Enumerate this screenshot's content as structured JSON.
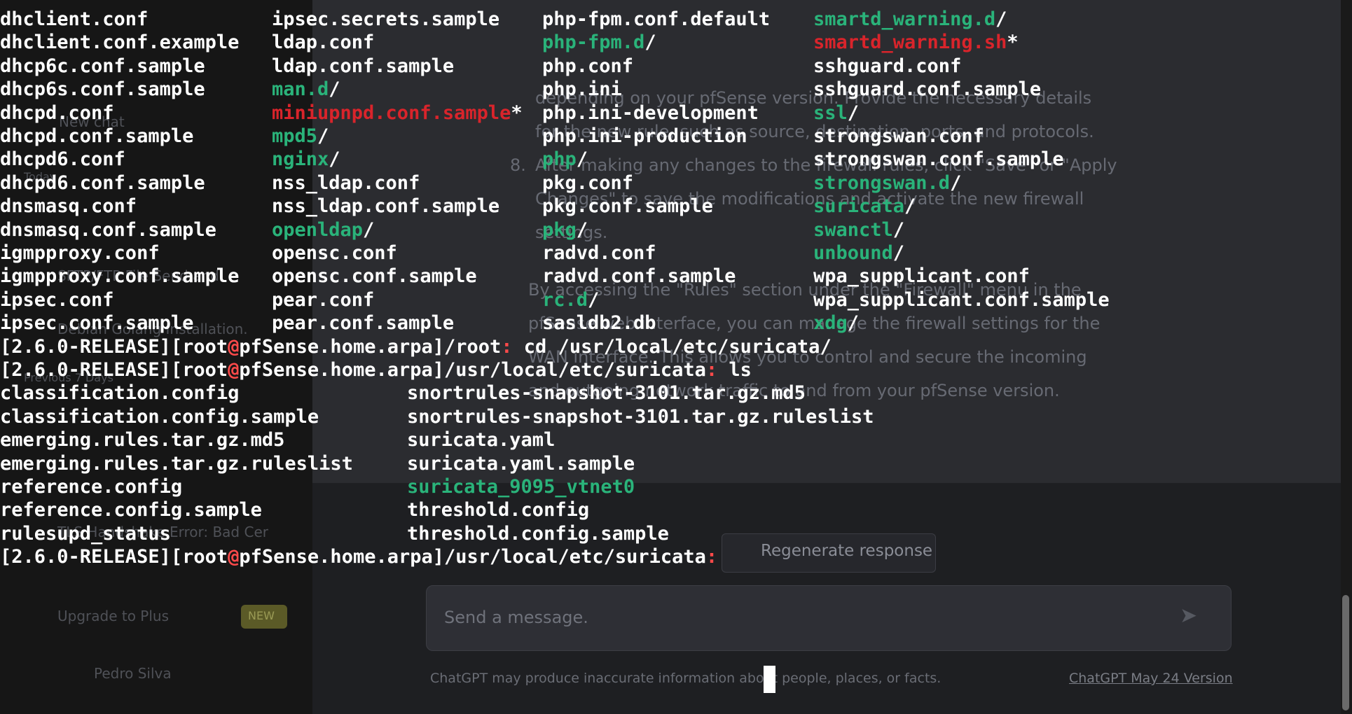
{
  "ls_etc": {
    "columns": [
      [
        {
          "name": "dhclient.conf",
          "kind": "file"
        },
        {
          "name": "dhclient.conf.example",
          "kind": "file"
        },
        {
          "name": "dhcp6c.conf.sample",
          "kind": "file"
        },
        {
          "name": "dhcp6s.conf.sample",
          "kind": "file"
        },
        {
          "name": "dhcpd.conf",
          "kind": "file"
        },
        {
          "name": "dhcpd.conf.sample",
          "kind": "file"
        },
        {
          "name": "dhcpd6.conf",
          "kind": "file"
        },
        {
          "name": "dhcpd6.conf.sample",
          "kind": "file"
        },
        {
          "name": "dnsmasq.conf",
          "kind": "file"
        },
        {
          "name": "dnsmasq.conf.sample",
          "kind": "file"
        },
        {
          "name": "igmpproxy.conf",
          "kind": "file"
        },
        {
          "name": "igmpproxy.conf.sample",
          "kind": "file"
        },
        {
          "name": "ipsec.conf",
          "kind": "file"
        },
        {
          "name": "ipsec.conf.sample",
          "kind": "file"
        }
      ],
      [
        {
          "name": "ipsec.secrets.sample",
          "kind": "file"
        },
        {
          "name": "ldap.conf",
          "kind": "file"
        },
        {
          "name": "ldap.conf.sample",
          "kind": "file"
        },
        {
          "name": "man.d",
          "kind": "dir",
          "suffix": "/"
        },
        {
          "name": "miniupnpd.conf.sample",
          "kind": "exec",
          "suffix": "*"
        },
        {
          "name": "mpd5",
          "kind": "dir",
          "suffix": "/"
        },
        {
          "name": "nginx",
          "kind": "dir",
          "suffix": "/"
        },
        {
          "name": "nss_ldap.conf",
          "kind": "file"
        },
        {
          "name": "nss_ldap.conf.sample",
          "kind": "file"
        },
        {
          "name": "openldap",
          "kind": "dir",
          "suffix": "/"
        },
        {
          "name": "opensc.conf",
          "kind": "file"
        },
        {
          "name": "opensc.conf.sample",
          "kind": "file"
        },
        {
          "name": "pear.conf",
          "kind": "file"
        },
        {
          "name": "pear.conf.sample",
          "kind": "file"
        }
      ],
      [
        {
          "name": "php-fpm.conf.default",
          "kind": "file"
        },
        {
          "name": "php-fpm.d",
          "kind": "dir",
          "suffix": "/"
        },
        {
          "name": "php.conf",
          "kind": "file"
        },
        {
          "name": "php.ini",
          "kind": "file"
        },
        {
          "name": "php.ini-development",
          "kind": "file"
        },
        {
          "name": "php.ini-production",
          "kind": "file"
        },
        {
          "name": "php",
          "kind": "dir",
          "suffix": "/"
        },
        {
          "name": "pkg.conf",
          "kind": "file"
        },
        {
          "name": "pkg.conf.sample",
          "kind": "file"
        },
        {
          "name": "pkg",
          "kind": "dir",
          "suffix": "/"
        },
        {
          "name": "radvd.conf",
          "kind": "file"
        },
        {
          "name": "radvd.conf.sample",
          "kind": "file"
        },
        {
          "name": "rc.d",
          "kind": "dir",
          "suffix": "/"
        },
        {
          "name": "sasldb2.db",
          "kind": "file"
        }
      ],
      [
        {
          "name": "smartd_warning.d",
          "kind": "dir",
          "suffix": "/"
        },
        {
          "name": "smartd_warning.sh",
          "kind": "exec",
          "suffix": "*"
        },
        {
          "name": "sshguard.conf",
          "kind": "file"
        },
        {
          "name": "sshguard.conf.sample",
          "kind": "file"
        },
        {
          "name": "ssl",
          "kind": "dir",
          "suffix": "/"
        },
        {
          "name": "strongswan.conf",
          "kind": "file"
        },
        {
          "name": "strongswan.conf.sample",
          "kind": "file"
        },
        {
          "name": "strongswan.d",
          "kind": "dir",
          "suffix": "/"
        },
        {
          "name": "suricata",
          "kind": "dir",
          "suffix": "/"
        },
        {
          "name": "swanctl",
          "kind": "dir",
          "suffix": "/"
        },
        {
          "name": "unbound",
          "kind": "dir",
          "suffix": "/"
        },
        {
          "name": "wpa_supplicant.conf",
          "kind": "file"
        },
        {
          "name": "wpa_supplicant.conf.sample",
          "kind": "file"
        },
        {
          "name": "xdg",
          "kind": "dir",
          "suffix": "/"
        }
      ]
    ]
  },
  "prompts": [
    {
      "version": "[2.6.0-RELEASE]",
      "user": "[root",
      "at": "@",
      "host": "pfSense.home.arpa]",
      "path": "/root",
      "colon": ":",
      "command": " cd /usr/local/etc/suricata/"
    },
    {
      "version": "[2.6.0-RELEASE]",
      "user": "[root",
      "at": "@",
      "host": "pfSense.home.arpa]",
      "path": "/usr/local/etc/suricata",
      "colon": ":",
      "command": " ls"
    },
    {
      "version": "[2.6.0-RELEASE]",
      "user": "[root",
      "at": "@",
      "host": "pfSense.home.arpa]",
      "path": "/usr/local/etc/suricata",
      "colon": ":",
      "command": " "
    }
  ],
  "ls_suricata": {
    "columns": [
      [
        {
          "name": "classification.config",
          "kind": "file"
        },
        {
          "name": "classification.config.sample",
          "kind": "file"
        },
        {
          "name": "emerging.rules.tar.gz.md5",
          "kind": "file"
        },
        {
          "name": "emerging.rules.tar.gz.ruleslist",
          "kind": "file"
        },
        {
          "name": "reference.config",
          "kind": "file"
        },
        {
          "name": "reference.config.sample",
          "kind": "file"
        },
        {
          "name": "rulesupd_status",
          "kind": "file"
        }
      ],
      [
        {
          "name": "snortrules-snapshot-3101.tar.gz.md5",
          "kind": "file"
        },
        {
          "name": "snortrules-snapshot-3101.tar.gz.ruleslist",
          "kind": "file"
        },
        {
          "name": "suricata.yaml",
          "kind": "file"
        },
        {
          "name": "suricata.yaml.sample",
          "kind": "file"
        },
        {
          "name": "suricata_9095_vtnet0",
          "kind": "dir"
        },
        {
          "name": "threshold.config",
          "kind": "file"
        },
        {
          "name": "threshold.config.sample",
          "kind": "file"
        }
      ]
    ]
  },
  "background": {
    "sidebar": [
      "New chat",
      "Today",
      "SFTP/FTP File Send and",
      "Debian Golang Installation.",
      "Previous 7 Days",
      "TLS Handshake Error: Bad Cer",
      "Upgrade to Plus",
      "NEW",
      "Pedro Silva"
    ],
    "main": [
      "depending on your pfSense version. Provide the necessary details",
      "for the new rule, such as source, destination, ports, and protocols.",
      "8.",
      "After making any changes to the firewall rules, click \"Save\" or \"Apply",
      "Changes\" to save the modifications and activate the new firewall",
      "settings.",
      "By accessing the \"Rules\" section under the \"Firewall\" menu in the",
      "pfSense web interface, you can manage the firewall settings for the",
      "WAN interface. This allows you to control and secure the incoming",
      "and outgoing network traffic to and from your pfSense version.",
      "Regenerate response",
      "Send a message.",
      "ChatGPT may produce inaccurate information about people, places, or facts.",
      "ChatGPT May 24 Version"
    ]
  },
  "colors": {
    "terminal_text": "#ffffff",
    "directory": "#2ab37a",
    "executable": "#d9242b",
    "prompt_at": "#ff4a4a"
  }
}
